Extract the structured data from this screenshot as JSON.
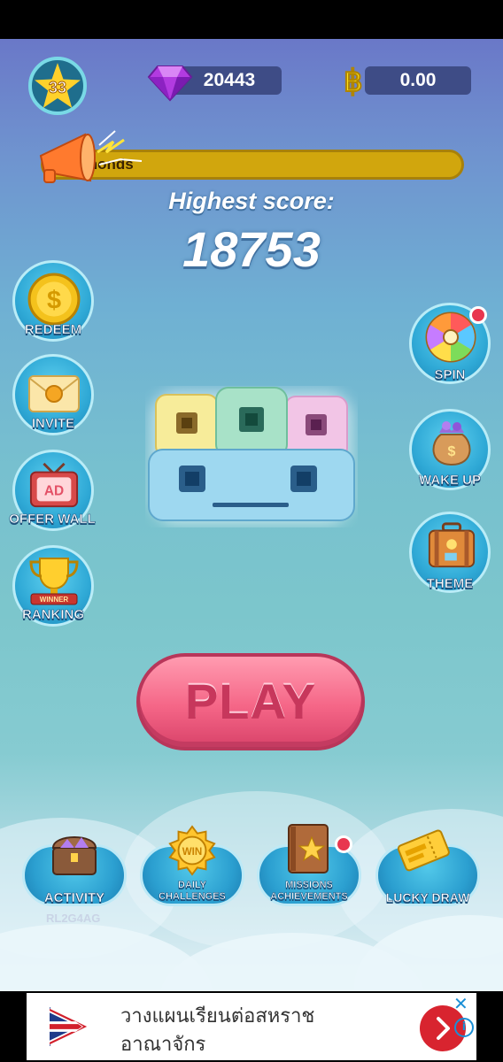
{
  "top_bar": {
    "level": "33",
    "diamonds": "20443",
    "currency_symbol": "฿",
    "balance": "0.00"
  },
  "ticker": {
    "text": "monds"
  },
  "score": {
    "label": "Highest score:",
    "value": "18753"
  },
  "left_menu": [
    {
      "label": "REDEEM",
      "icon": "coin-icon"
    },
    {
      "label": "INVITE",
      "icon": "envelope-icon"
    },
    {
      "label": "OFFER WALL",
      "icon": "tv-ad-icon"
    },
    {
      "label": "RANKING",
      "icon": "trophy-icon"
    }
  ],
  "right_menu": [
    {
      "label": "SPIN",
      "icon": "wheel-icon",
      "badge": true
    },
    {
      "label": "WAKE UP",
      "icon": "money-bag-icon"
    },
    {
      "label": "THEME",
      "icon": "suitcase-icon"
    }
  ],
  "play_label": "PLAY",
  "bottom_menu": [
    {
      "label": "ACTIVITY",
      "icon": "chest-icon"
    },
    {
      "label1": "DAILY",
      "label2": "CHALLENGES",
      "icon": "win-medal-icon",
      "medal_text": "WIN"
    },
    {
      "label1": "MISSIONS",
      "label2": "ACHIEVEMENTS",
      "icon": "book-icon",
      "badge": true
    },
    {
      "label": "LUCKY DRAW",
      "icon": "ticket-icon"
    }
  ],
  "trophy_ribbon": "WINNER",
  "ad_icon_text": "AD",
  "user_code": "RL2G4AG",
  "ad_banner": {
    "line1": "วางแผนเรียนต่อสหราช",
    "line2": "อาณาจักร",
    "close_glyph": "✕",
    "info_glyph": "i",
    "colors": {
      "accent": "#d8242f",
      "info": "#1a8fd6"
    }
  }
}
